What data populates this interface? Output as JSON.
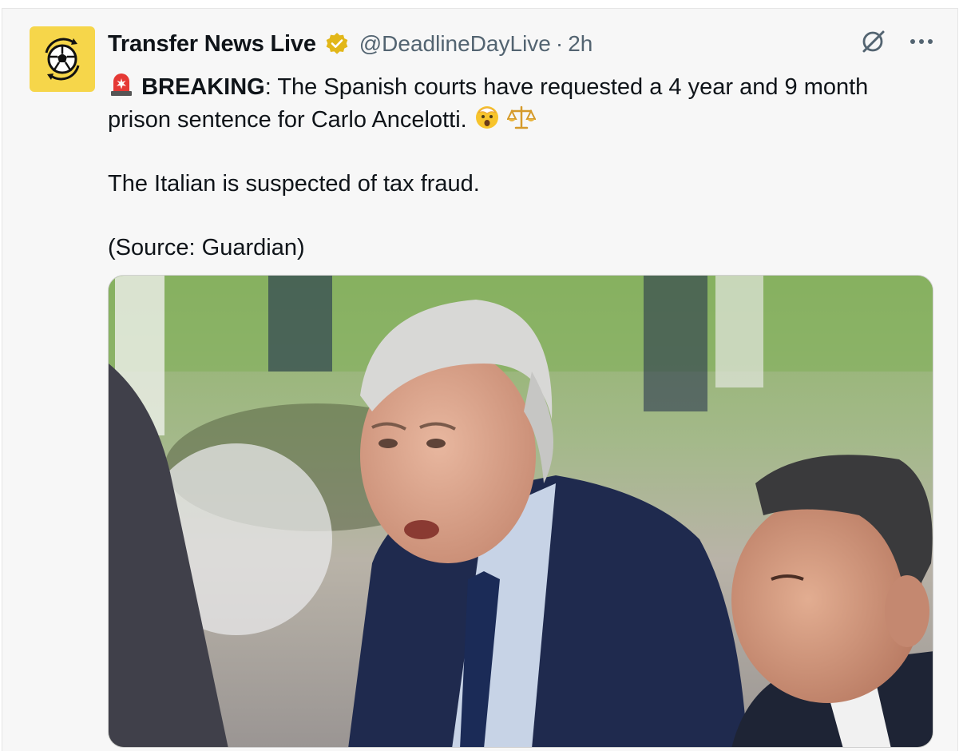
{
  "tweet": {
    "author_name": "Transfer News Live",
    "handle": "@DeadlineDayLive",
    "separator": "·",
    "time": "2h",
    "verified": true,
    "avatar_icon": "soccer-ball-icon",
    "text": {
      "breaking_label": "BREAKING",
      "line1_rest": ": The Spanish courts have requested a 4 year and 9 month prison sentence for Carlo Ancelotti.",
      "line2": "The Italian is suspected of tax fraud.",
      "line3": "(Source: Guardian)"
    },
    "emojis": [
      "siren-icon",
      "shocked-face-icon",
      "scales-icon"
    ]
  },
  "actions": {
    "grok_icon": "grok-icon",
    "more_icon": "more-icon"
  },
  "colors": {
    "avatar_bg": "#f6d64a",
    "verified_gold": "#e2b719",
    "handle_gray": "#536471"
  }
}
